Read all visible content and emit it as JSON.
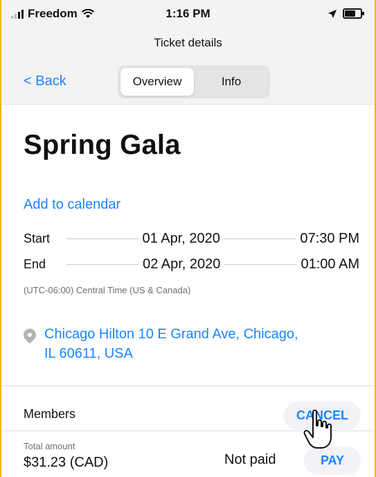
{
  "status_bar": {
    "carrier": "Freedom",
    "time": "1:16 PM"
  },
  "nav": {
    "title": "Ticket details",
    "back": "< Back",
    "tabs": [
      "Overview",
      "Info"
    ],
    "active_tab": "Overview"
  },
  "event": {
    "title": "Spring Gala",
    "add_to_calendar": "Add to calendar",
    "start_label": "Start",
    "start_date": "01 Apr, 2020",
    "start_time": "07:30 PM",
    "end_label": "End",
    "end_date": "02 Apr, 2020",
    "end_time": "01:00 AM",
    "timezone": "(UTC-06:00) Central Time (US & Canada)",
    "location_line1": "Chicago Hilton 10 E Grand Ave, Chicago,",
    "location_line2": "IL 60611, USA"
  },
  "members": {
    "label": "Members",
    "cancel": "CANCEL"
  },
  "payment": {
    "total_label": "Total amount",
    "amount": "$31.23 (CAD)",
    "status": "Not paid",
    "pay": "PAY"
  },
  "colors": {
    "accent": "#1a84ff",
    "frame_border": "#f2b705"
  }
}
